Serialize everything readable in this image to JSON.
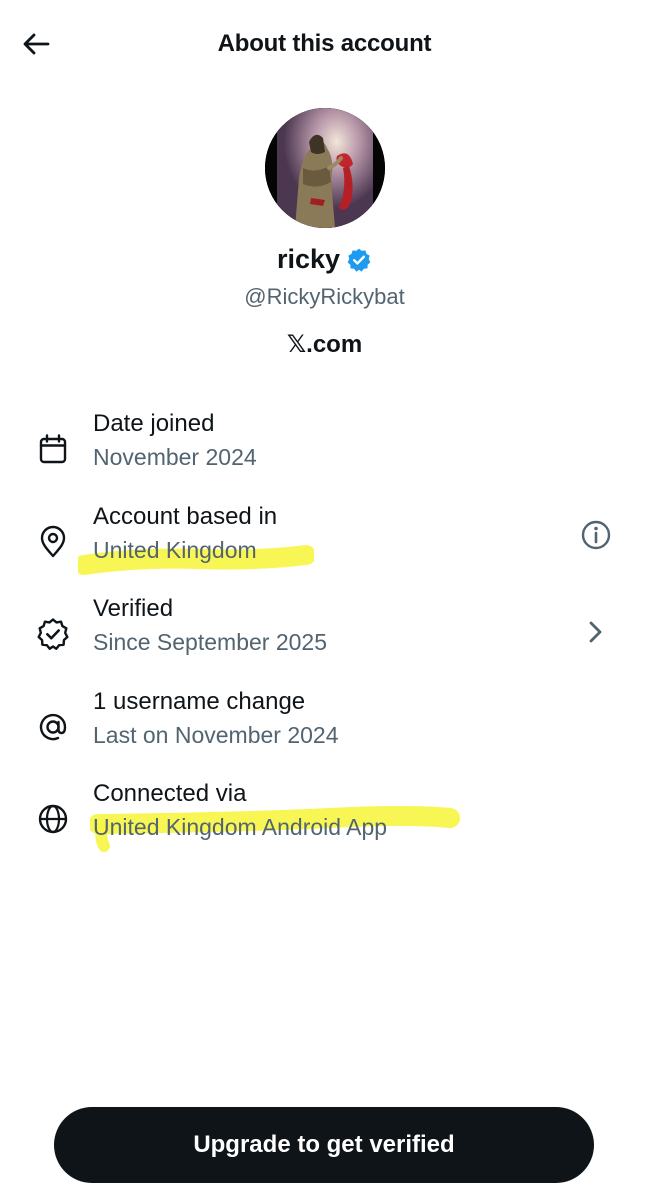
{
  "header": {
    "title": "About this account",
    "back_icon": "arrow-left-icon"
  },
  "profile": {
    "name": "ricky",
    "handle": "@RickyRickybat",
    "site_prefix": "𝕏",
    "site_suffix": ".com",
    "verified_badge_color": "#1d9bf0"
  },
  "rows": [
    {
      "icon": "calendar-icon",
      "label": "Date joined",
      "value": "November 2024"
    },
    {
      "icon": "location-pin-icon",
      "label": "Account based in",
      "value": "United Kingdom",
      "trailing_icon": "info-icon",
      "highlighted": true
    },
    {
      "icon": "verified-badge-icon",
      "label": "Verified",
      "value": "Since September 2025",
      "trailing_icon": "chevron-right-icon"
    },
    {
      "icon": "at-sign-icon",
      "label": "1 username change",
      "value": "Last on November 2024"
    },
    {
      "icon": "globe-icon",
      "label": "Connected via",
      "value": "United Kingdom Android App",
      "highlighted": true
    }
  ],
  "footer": {
    "upgrade_label": "Upgrade to get verified"
  },
  "colors": {
    "text_primary": "#0f1419",
    "text_secondary": "#536471",
    "highlight": "#f7f542",
    "button_bg": "#0f1419"
  }
}
